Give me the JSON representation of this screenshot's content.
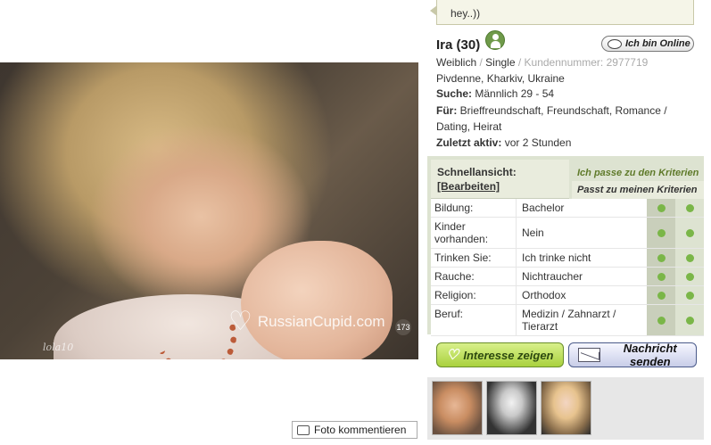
{
  "status_message": "hey..))",
  "profile": {
    "name_age": "Ira (30)",
    "online_label": "Ich bin Online",
    "gender": "Weiblich",
    "status": "Single",
    "customer_number": "Kundennummer: 2977719",
    "location": "Pivdenne, Kharkiv, Ukraine",
    "search_label": "Suche:",
    "search_value": "Männlich 29 - 54",
    "for_label": "Für:",
    "for_value_line1": "Brieffreundschaft, Freundschaft, Romance /",
    "for_value_line2": "Dating, Heirat",
    "last_active_label": "Zuletzt aktiv:",
    "last_active_value": "vor 2 Stunden"
  },
  "photo": {
    "watermark": "RussianCupid.com",
    "count": "173",
    "signature": "lola10",
    "comment_button": "Foto kommentieren"
  },
  "quick_view": {
    "title": "Schnellansicht:",
    "edit_link": "[Bearbeiten]",
    "criteria_1": "Ich passe zu den Kriterien",
    "criteria_2": "Passt zu meinen Kriterien",
    "rows": [
      {
        "key": "Bildung:",
        "value": "Bachelor"
      },
      {
        "key": "Kinder vorhanden:",
        "value": "Nein"
      },
      {
        "key": "Trinken Sie:",
        "value": "Ich trinke nicht"
      },
      {
        "key": "Rauche:",
        "value": "Nichtraucher"
      },
      {
        "key": "Religion:",
        "value": "Orthodox"
      },
      {
        "key": "Beruf:",
        "value": "Medizin / Zahnarzt / Tierarzt"
      }
    ]
  },
  "actions": {
    "interest": "Interesse zeigen",
    "message": "Nachricht senden"
  },
  "colors": {
    "match_dot": "#7ab648",
    "panel_green": "#dde3d1"
  }
}
